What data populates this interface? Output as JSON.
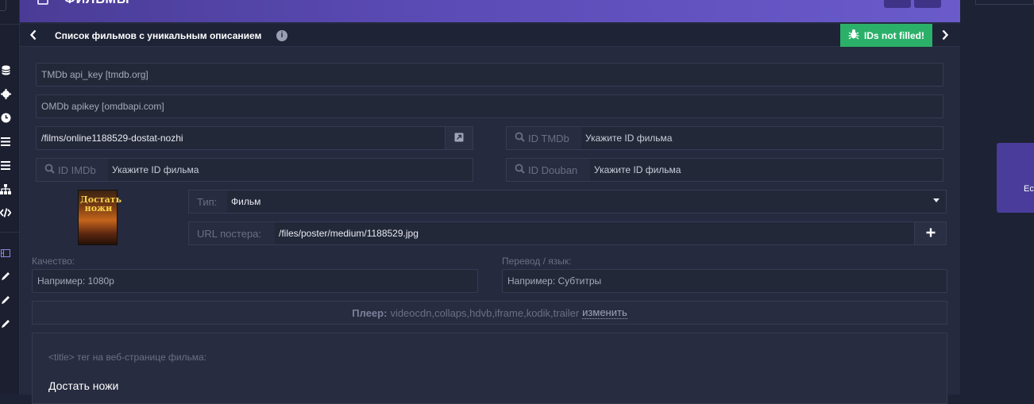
{
  "header": {
    "title": "ФИЛЬМЫ",
    "subtitle": "Список фильмов с уникальным описанием",
    "status_badge": "IDs not filled!"
  },
  "rail": {
    "icons": [
      "database-icon",
      "gear-icon",
      "clock-icon",
      "list-icon",
      "list-icon",
      "sitemap-icon",
      "code-icon",
      "film-icon",
      "pencil-icon",
      "pencil-icon",
      "pencil-icon"
    ]
  },
  "form": {
    "tmdb_key": "TMDb api_key [tmdb.org]",
    "omdb_key": "OMDb apikey [omdbapi.com]",
    "url_path": "/films/online1188529-dostat-nozhi",
    "id_tmdb_label": "ID TMDb",
    "id_tmdb_placeholder": "Укажите ID фильма",
    "id_imdb_label": "ID IMDb",
    "id_imdb_placeholder": "Укажите ID фильма",
    "id_douban_label": "ID Douban",
    "id_douban_placeholder": "Укажите ID фильма",
    "type_label": "Тип:",
    "type_value": "Фильм",
    "poster_label": "URL постера:",
    "poster_value": "/files/poster/medium/1188529.jpg",
    "poster_text": "Достать ножи",
    "quality_label": "Качество:",
    "quality_placeholder": "Например: 1080p",
    "translation_label": "Перевод / язык:",
    "translation_placeholder": "Например: Субтитры",
    "player_label": "Плеер:",
    "player_value": "videocdn,collaps,hdvb,iframe,kodik,trailer",
    "player_change": "изменить",
    "title_tag_label": "<title> тег на веб-странице фильма:",
    "title_tag_value": "Достать ножи"
  },
  "right_panel": {
    "text": "Ec"
  },
  "colors": {
    "accent": "#5b4bb6",
    "badge": "#2bb069",
    "background": "#1e2235"
  }
}
